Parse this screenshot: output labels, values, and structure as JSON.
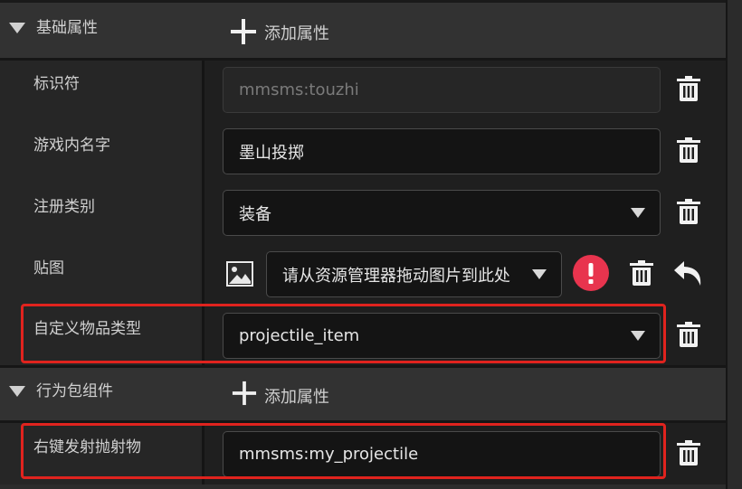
{
  "sections": {
    "basic": {
      "title": "基础属性",
      "add_label": "添加属性"
    },
    "behavior": {
      "title": "行为包组件",
      "add_label": "添加属性"
    }
  },
  "fields": {
    "identifier": {
      "label": "标识符",
      "value": "mmsms:touzhi"
    },
    "game_name": {
      "label": "游戏内名字",
      "value": "墨山投掷"
    },
    "register_category": {
      "label": "注册类别",
      "value": "装备"
    },
    "texture": {
      "label": "贴图",
      "value": "请从资源管理器拖动图片到此处"
    },
    "custom_item_type": {
      "label": "自定义物品类型",
      "value": "projectile_item"
    },
    "right_click_projectile": {
      "label": "右键发射抛射物",
      "value": "mmsms:my_projectile"
    }
  },
  "colors": {
    "highlight": "#e0231e",
    "warning": "#e8344e"
  },
  "icons": [
    "chevron-down-icon",
    "plus-icon",
    "trash-icon",
    "image-icon",
    "warning-icon",
    "undo-icon"
  ]
}
